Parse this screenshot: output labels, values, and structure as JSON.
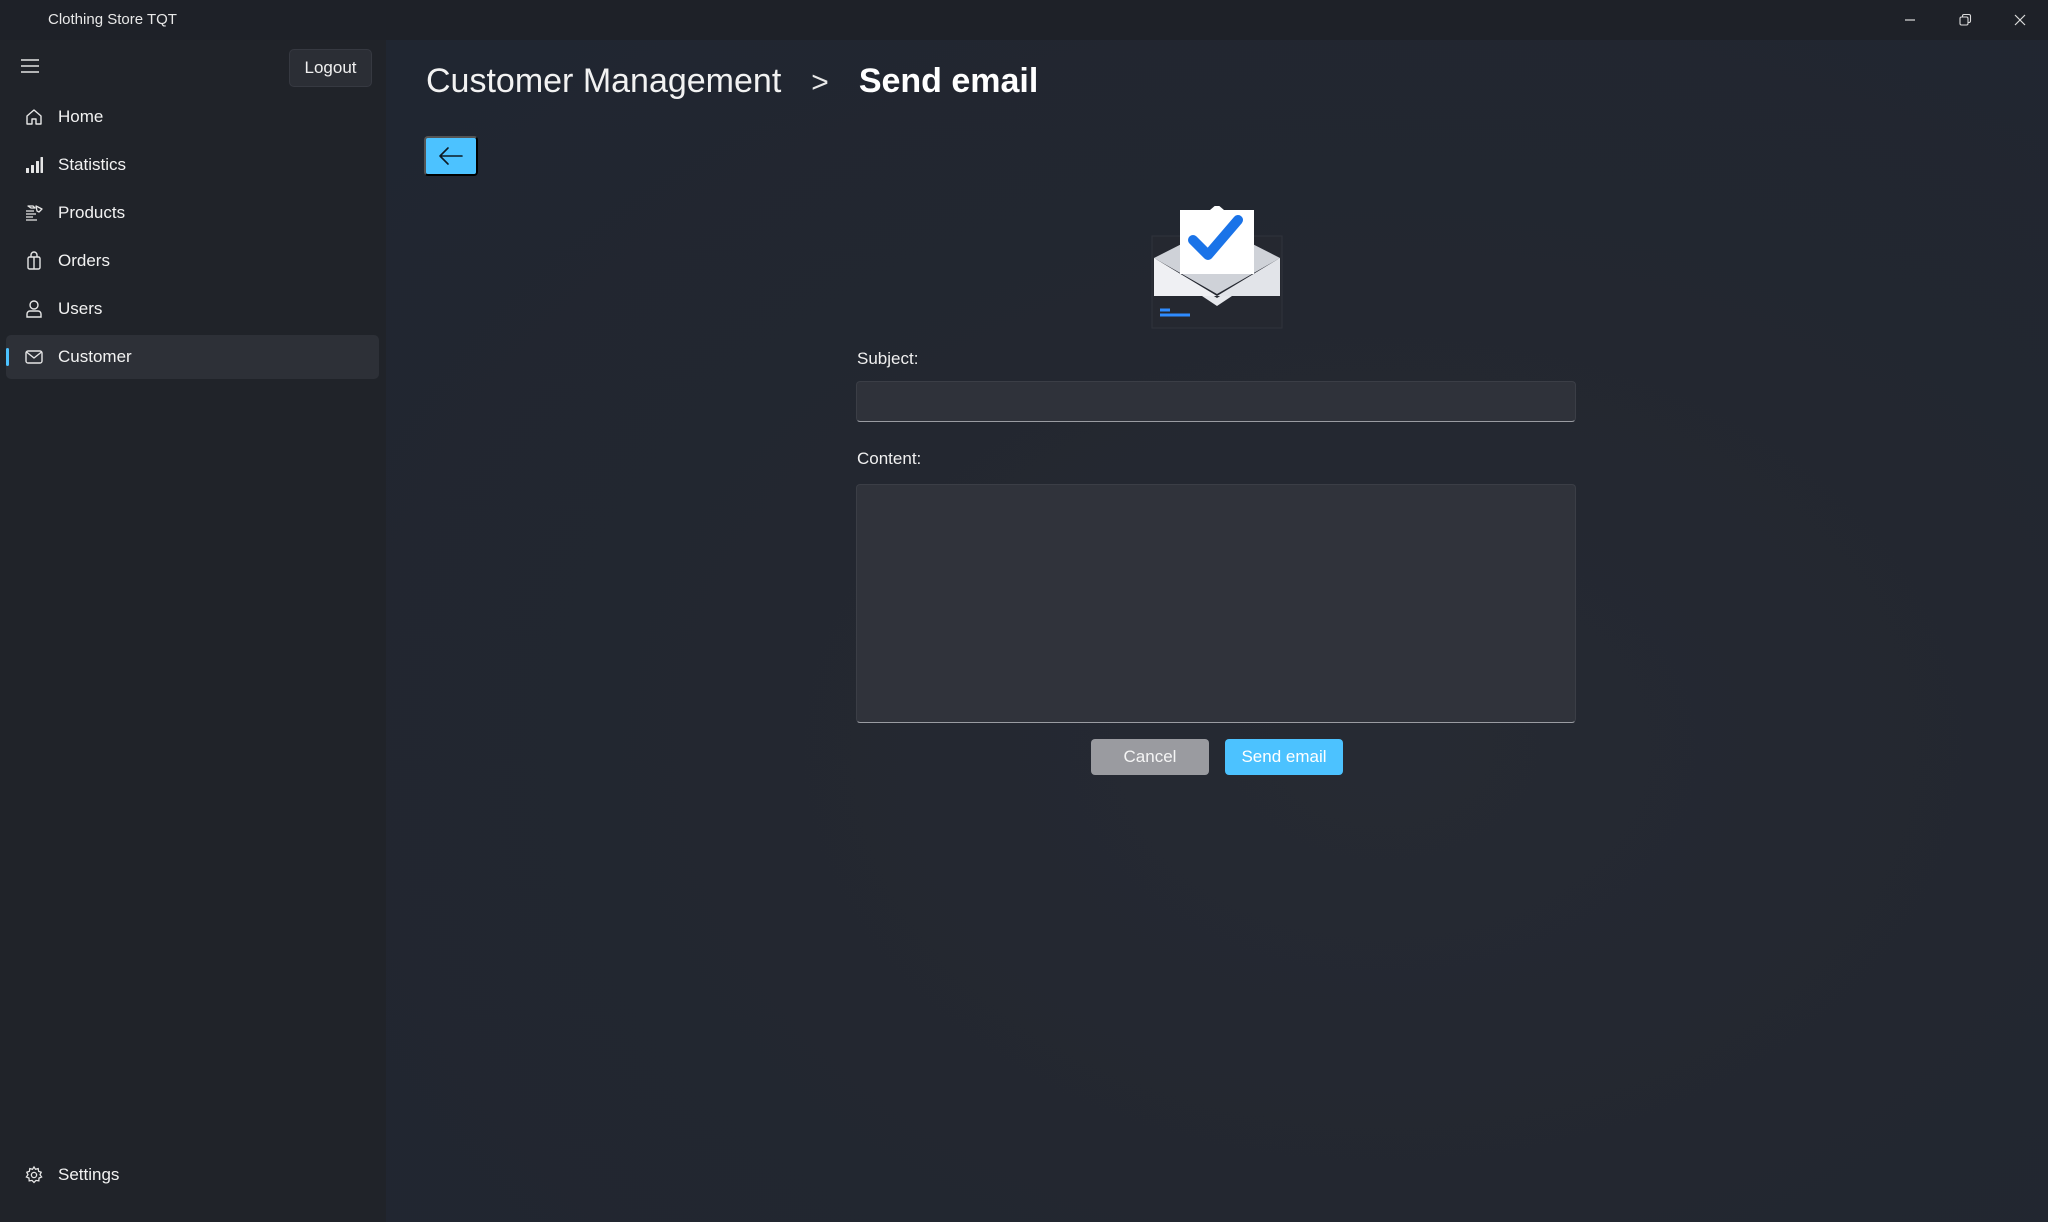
{
  "window": {
    "title": "Clothing Store TQT",
    "controls": {
      "minimize": "minimize-icon",
      "maximize": "restore-icon",
      "close": "close-icon"
    }
  },
  "sidebar": {
    "logout_label": "Logout",
    "items": [
      {
        "label": "Home",
        "icon": "home-icon"
      },
      {
        "label": "Statistics",
        "icon": "bar-chart-icon"
      },
      {
        "label": "Products",
        "icon": "products-icon"
      },
      {
        "label": "Orders",
        "icon": "shopping-bag-icon"
      },
      {
        "label": "Users",
        "icon": "user-icon"
      },
      {
        "label": "Customer",
        "icon": "mail-icon",
        "active": true
      }
    ],
    "settings_label": "Settings"
  },
  "main": {
    "breadcrumb": {
      "parent": "Customer Management",
      "separator": ">",
      "current": "Send email"
    },
    "back_icon": "arrow-left-icon",
    "illustration": "email-check-icon",
    "form": {
      "subject_label": "Subject:",
      "subject_value": "",
      "content_label": "Content:",
      "content_value": "",
      "cancel_label": "Cancel",
      "send_label": "Send email"
    }
  },
  "colors": {
    "accent": "#4cc2ff",
    "sidebar_bg": "#202329",
    "content_bg": "#232730",
    "cancel_bg": "#9a9ba0"
  }
}
